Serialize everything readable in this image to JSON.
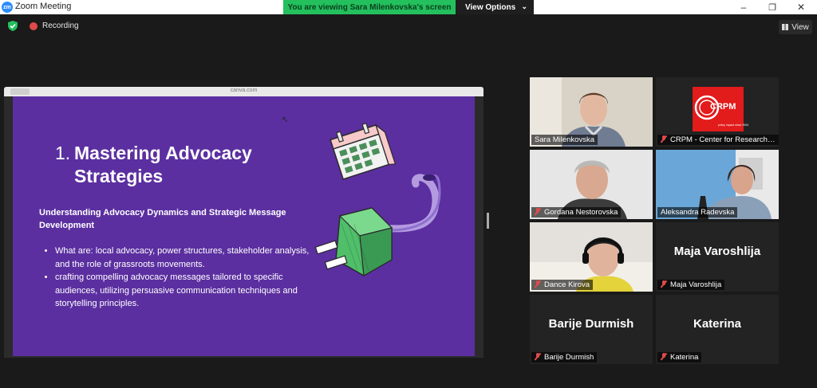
{
  "window": {
    "title": "Zoom Meeting",
    "logo_text": "zm"
  },
  "share_banner": {
    "viewing_text": "You are viewing Sara Milenkovska's screen",
    "view_options_label": "View Options"
  },
  "topbar": {
    "recording_label": "Recording",
    "view_label": "View"
  },
  "shared_screen": {
    "url": "canva.com",
    "slide": {
      "number": "1.",
      "title_line1": "Mastering Advocacy",
      "title_line2": "Strategies",
      "subtitle": "Understanding Advocacy Dynamics and Strategic Message Development",
      "bullets": [
        "What are: local advocacy, power structures, stakeholder analysis, and the role of grassroots movements.",
        "crafting compelling advocacy messages tailored to specific audiences, utilizing persuasive communication techniques and storytelling principles."
      ]
    }
  },
  "participants": [
    {
      "name": "Sara Milenkovska",
      "muted": false,
      "video": true
    },
    {
      "name": "CRPM - Center for Research and Policy Making",
      "muted": true,
      "video": true,
      "logo_text": "CRPM",
      "logo_tagline": "policy impact since 2004"
    },
    {
      "name": "Gordana Nestorovska",
      "muted": true,
      "video": true
    },
    {
      "name": "Aleksandra Radevska",
      "muted": false,
      "video": true,
      "active_speaker": true
    },
    {
      "name": "Dance Kirova",
      "muted": true,
      "video": true
    },
    {
      "name": "Maja Varoshlija",
      "muted": true,
      "video": false
    },
    {
      "name": "Barije Durmish",
      "muted": true,
      "video": false
    },
    {
      "name": "Katerina",
      "muted": true,
      "video": false
    }
  ],
  "colors": {
    "banner_green": "#23c05d",
    "slide_purple": "#5b2fa0",
    "active_outline": "#d7e86a",
    "mute_red": "#e04a4a"
  }
}
